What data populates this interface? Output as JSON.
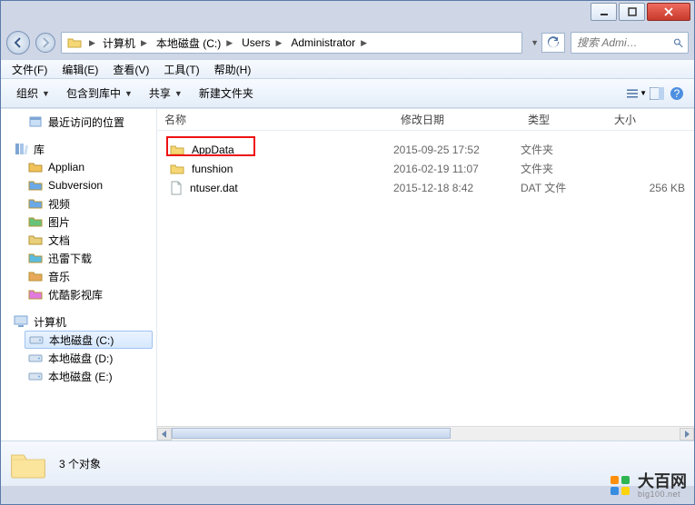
{
  "window": {
    "minimize": "",
    "maximize": "",
    "close": ""
  },
  "breadcrumb": {
    "segments": [
      "计算机",
      "本地磁盘 (C:)",
      "Users",
      "Administrator"
    ]
  },
  "refresh_title": "刷新",
  "search": {
    "placeholder": "搜索 Admi…"
  },
  "menubar": {
    "file": "文件(F)",
    "edit": "编辑(E)",
    "view": "查看(V)",
    "tools": "工具(T)",
    "help": "帮助(H)"
  },
  "toolbar": {
    "organize": "组织",
    "include": "包含到库中",
    "share": "共享",
    "new_folder": "新建文件夹"
  },
  "nav": {
    "recent": "最近访问的位置",
    "libraries": "库",
    "lib_items": [
      "Applian",
      "Subversion",
      "视频",
      "图片",
      "文档",
      "迅雷下载",
      "音乐",
      "优酷影视库"
    ],
    "computer": "计算机",
    "drives": [
      "本地磁盘 (C:)",
      "本地磁盘 (D:)",
      "本地磁盘 (E:)"
    ]
  },
  "columns": {
    "name": "名称",
    "date": "修改日期",
    "type": "类型",
    "size": "大小"
  },
  "rows": [
    {
      "icon": "folder",
      "name": "AppData",
      "date": "2015-09-25 17:52",
      "type": "文件夹",
      "size": ""
    },
    {
      "icon": "folder",
      "name": "funshion",
      "date": "2016-02-19 11:07",
      "type": "文件夹",
      "size": ""
    },
    {
      "icon": "file",
      "name": "ntuser.dat",
      "date": "2015-12-18 8:42",
      "type": "DAT 文件",
      "size": "256 KB"
    }
  ],
  "status": {
    "count": "3 个对象"
  },
  "watermark": {
    "title": "大百网",
    "sub": "big100.net"
  }
}
